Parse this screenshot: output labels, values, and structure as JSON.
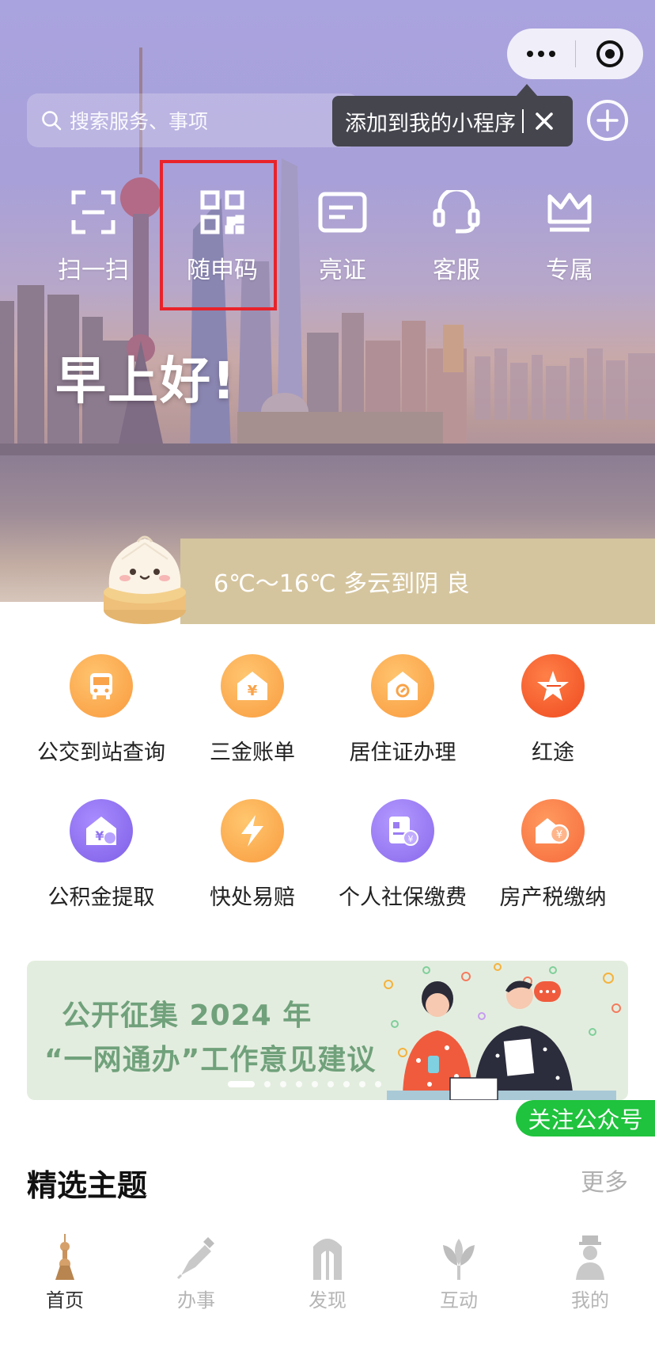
{
  "capsule": {
    "more_icon": "more-dots-icon",
    "close_icon": "target-circle-icon"
  },
  "search": {
    "placeholder": "搜索服务、事项"
  },
  "tooltip": {
    "text": "添加到我的小程序"
  },
  "quick_actions": [
    {
      "label": "扫一扫",
      "icon": "scan-icon"
    },
    {
      "label": "随申码",
      "icon": "qr-code-icon"
    },
    {
      "label": "亮证",
      "icon": "id-card-icon"
    },
    {
      "label": "客服",
      "icon": "headset-icon"
    },
    {
      "label": "专属",
      "icon": "crown-icon"
    }
  ],
  "greeting": "早上好!",
  "weather": {
    "text": "6℃～16℃ 多云到阴 良"
  },
  "services": [
    {
      "label": "公交到站查询",
      "icon": "bus-icon",
      "color": "#f9a34a"
    },
    {
      "label": "三金账单",
      "icon": "house-yen-icon",
      "color": "#f9a74b"
    },
    {
      "label": "居住证办理",
      "icon": "residence-icon",
      "color": "#f9a54a"
    },
    {
      "label": "红途",
      "icon": "star-icon",
      "color": "#f4572a"
    },
    {
      "label": "公积金提取",
      "icon": "fund-icon",
      "color": "#8f72f0"
    },
    {
      "label": "快处易赔",
      "icon": "lightning-icon",
      "color": "#f8a84a"
    },
    {
      "label": "个人社保缴费",
      "icon": "social-security-icon",
      "color": "#9b7cf2"
    },
    {
      "label": "房产税缴纳",
      "icon": "property-tax-icon",
      "color": "#f8754a"
    }
  ],
  "banner": {
    "line1": "公开征集 2024 年",
    "line2": "“一网通办”工作意见建议",
    "slides": 9,
    "active_slide": 1
  },
  "follow": {
    "label": "关注公众号"
  },
  "section": {
    "title": "精选主题",
    "more": "更多"
  },
  "tabs": [
    {
      "label": "首页",
      "icon": "tower-icon",
      "active": true
    },
    {
      "label": "办事",
      "icon": "pen-icon",
      "active": false
    },
    {
      "label": "发现",
      "icon": "arch-icon",
      "active": false
    },
    {
      "label": "互动",
      "icon": "flower-icon",
      "active": false
    },
    {
      "label": "我的",
      "icon": "person-icon",
      "active": false
    }
  ],
  "colors": {
    "highlight": "#e8232a",
    "follow_green": "#1fc33d",
    "banner_text": "#70a17b",
    "weather_bar": "#d5c59e"
  }
}
